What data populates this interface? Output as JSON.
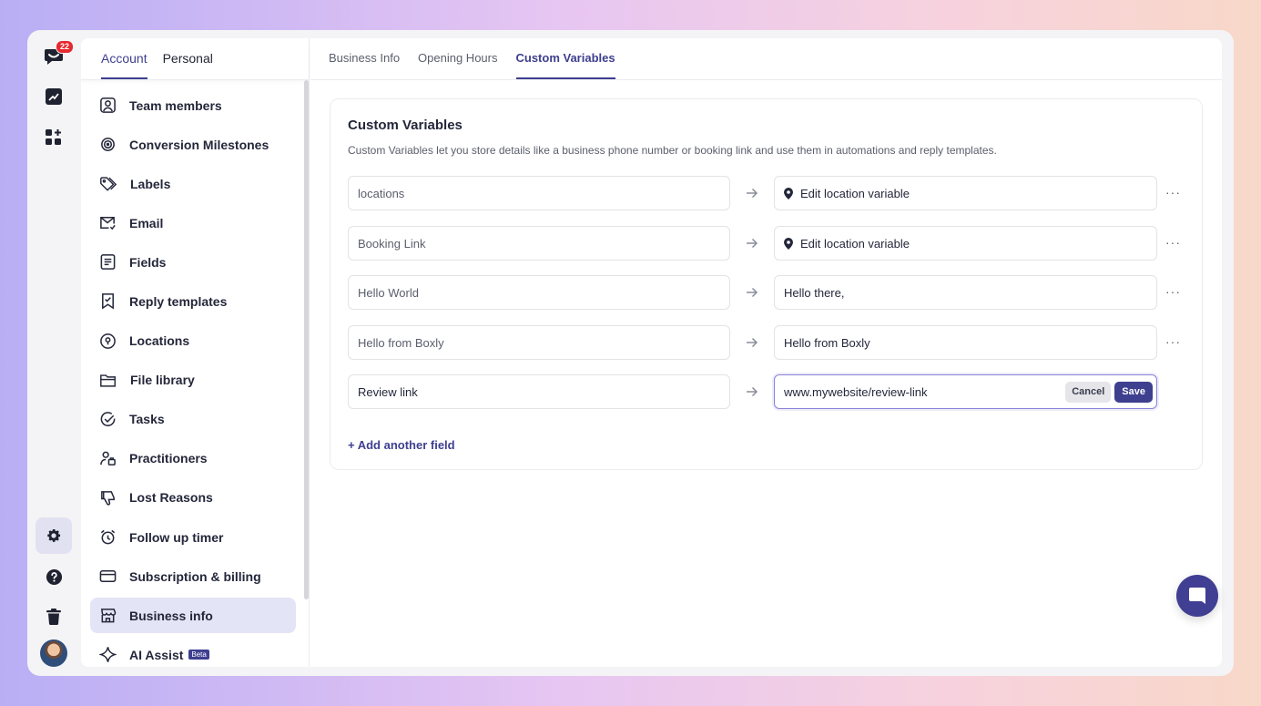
{
  "rail": {
    "notification_count": "22"
  },
  "settings_nav": {
    "tabs": [
      {
        "label": "Account"
      },
      {
        "label": "Personal"
      }
    ],
    "items": [
      {
        "label": "Team members",
        "icon": "team-members-icon"
      },
      {
        "label": "Conversion Milestones",
        "icon": "target-icon"
      },
      {
        "label": "Labels",
        "icon": "tag-icon"
      },
      {
        "label": "Email",
        "icon": "email-icon"
      },
      {
        "label": "Fields",
        "icon": "fields-icon"
      },
      {
        "label": "Reply templates",
        "icon": "reply-template-icon"
      },
      {
        "label": "Locations",
        "icon": "location-pin-icon"
      },
      {
        "label": "File library",
        "icon": "folder-icon"
      },
      {
        "label": "Tasks",
        "icon": "check-circle-icon"
      },
      {
        "label": "Practitioners",
        "icon": "practitioner-icon"
      },
      {
        "label": "Lost Reasons",
        "icon": "thumbs-down-icon"
      },
      {
        "label": "Follow up timer",
        "icon": "alarm-clock-icon"
      },
      {
        "label": "Subscription & billing",
        "icon": "credit-card-icon"
      },
      {
        "label": "Business info",
        "icon": "store-icon"
      },
      {
        "label": "AI Assist",
        "icon": "sparkle-icon",
        "badge": "Beta"
      }
    ]
  },
  "content": {
    "tabs": [
      {
        "label": "Business Info"
      },
      {
        "label": "Opening Hours"
      },
      {
        "label": "Custom Variables"
      }
    ],
    "panel": {
      "title": "Custom Variables",
      "description": "Custom Variables let you store details like a business phone number or booking link and use them in automations and reply templates.",
      "rows": [
        {
          "key": "locations",
          "value": "Edit location variable"
        },
        {
          "key": "Booking Link",
          "value": "Edit location variable"
        },
        {
          "key": "Hello World",
          "value": "Hello there,"
        },
        {
          "key": "Hello from Boxly",
          "value": "Hello from Boxly"
        },
        {
          "key": "Review link",
          "value": "www.mywebsite/review-link"
        }
      ],
      "more_label": "···",
      "cancel_label": "Cancel",
      "save_label": "Save",
      "add_field_label": "+ Add another field"
    }
  },
  "colors": {
    "accent": "#3e3f8f",
    "active_bg": "#e4e4f7",
    "badge": "#e5292f"
  }
}
